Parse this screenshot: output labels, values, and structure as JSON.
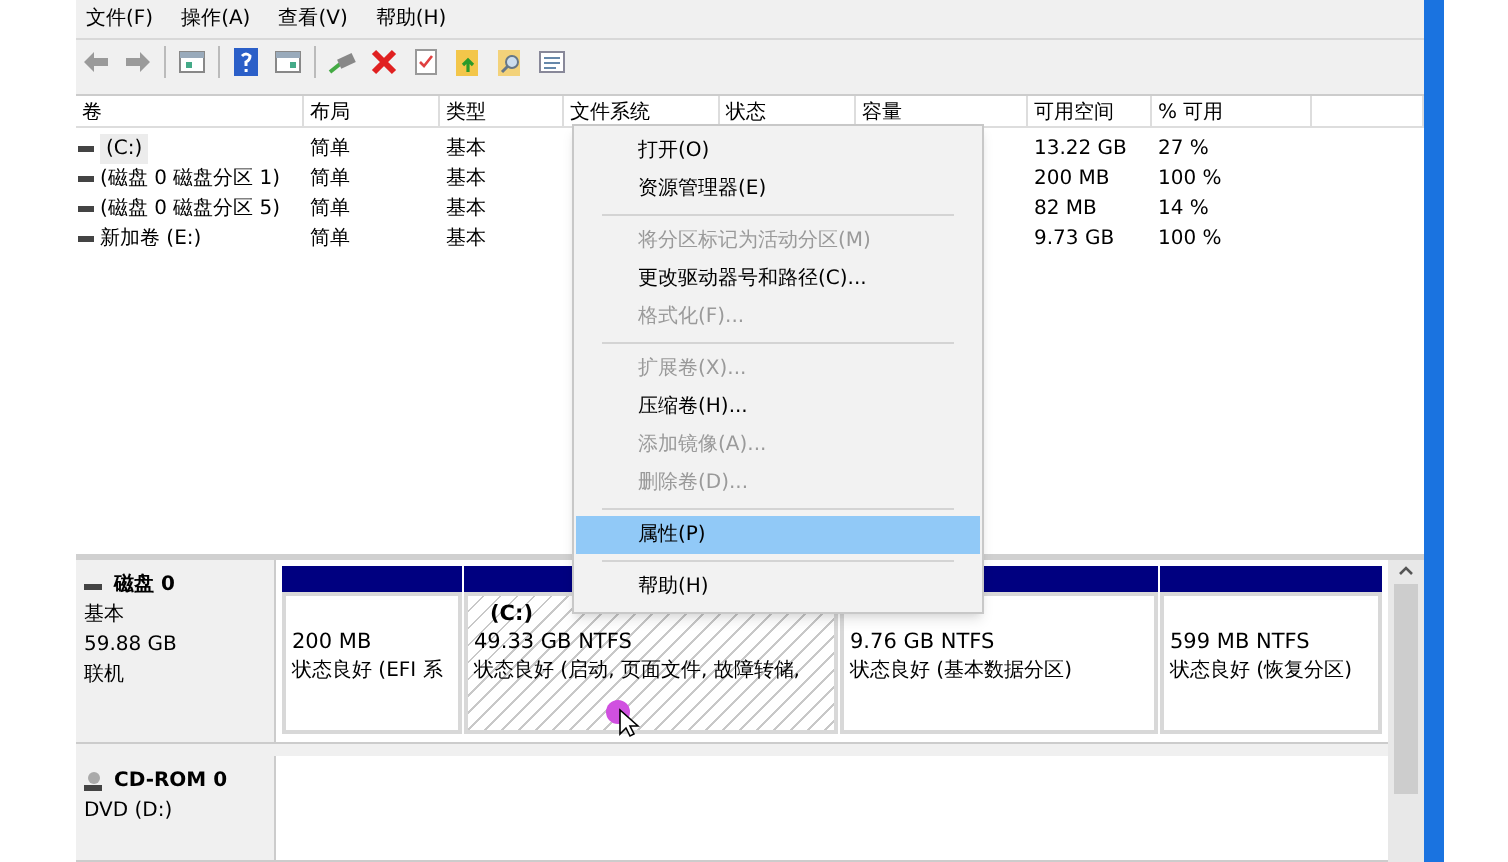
{
  "menu_bar": [
    {
      "label": "文件(F)"
    },
    {
      "label": "操作(A)"
    },
    {
      "label": "查看(V)"
    },
    {
      "label": "帮助(H)"
    }
  ],
  "volume_table": {
    "columns": [
      "卷",
      "布局",
      "类型",
      "文件系统",
      "状态",
      "容量",
      "可用空间",
      "% 可用"
    ],
    "rows": [
      {
        "volume": "(C:)",
        "layout": "简单",
        "type": "基本",
        "free": "13.22 GB",
        "percent": "27 %",
        "selected": true
      },
      {
        "volume": "(磁盘 0 磁盘分区 1)",
        "layout": "简单",
        "type": "基本",
        "free": "200 MB",
        "percent": "100 %",
        "selected": false
      },
      {
        "volume": "(磁盘 0 磁盘分区 5)",
        "layout": "简单",
        "type": "基本",
        "free": "82 MB",
        "percent": "14 %",
        "selected": false
      },
      {
        "volume": "新加卷 (E:)",
        "layout": "简单",
        "type": "基本",
        "free": "9.73 GB",
        "percent": "100 %",
        "selected": false
      }
    ]
  },
  "context_menu": [
    {
      "kind": "item",
      "label": "打开(O)",
      "disabled": false,
      "selected": false
    },
    {
      "kind": "item",
      "label": "资源管理器(E)",
      "disabled": false,
      "selected": false
    },
    {
      "kind": "separator"
    },
    {
      "kind": "item",
      "label": "将分区标记为活动分区(M)",
      "disabled": true,
      "selected": false
    },
    {
      "kind": "item",
      "label": "更改驱动器号和路径(C)...",
      "disabled": false,
      "selected": false
    },
    {
      "kind": "item",
      "label": "格式化(F)...",
      "disabled": true,
      "selected": false
    },
    {
      "kind": "separator"
    },
    {
      "kind": "item",
      "label": "扩展卷(X)...",
      "disabled": true,
      "selected": false
    },
    {
      "kind": "item",
      "label": "压缩卷(H)...",
      "disabled": false,
      "selected": false
    },
    {
      "kind": "item",
      "label": "添加镜像(A)...",
      "disabled": true,
      "selected": false
    },
    {
      "kind": "item",
      "label": "删除卷(D)...",
      "disabled": true,
      "selected": false
    },
    {
      "kind": "separator"
    },
    {
      "kind": "item",
      "label": "属性(P)",
      "disabled": false,
      "selected": true
    },
    {
      "kind": "separator"
    },
    {
      "kind": "item",
      "label": "帮助(H)",
      "disabled": false,
      "selected": false
    }
  ],
  "disks": [
    {
      "kind": "disk",
      "name": "磁盘 0",
      "lines": [
        "基本",
        "59.88 GB",
        "联机"
      ],
      "partitions": [
        {
          "size": "200 MB",
          "status": "状态良好 (EFI 系",
          "selected": false
        },
        {
          "title": "(C:)",
          "size": "49.33 GB NTFS",
          "status": "状态良好 (启动, 页面文件, 故障转储,",
          "selected": true
        },
        {
          "size": "9.76 GB NTFS",
          "status": "状态良好 (基本数据分区)",
          "selected": false
        },
        {
          "size": "599 MB NTFS",
          "status": "状态良好 (恢复分区)",
          "selected": false
        }
      ]
    },
    {
      "kind": "cdrom",
      "name": "CD-ROM 0",
      "lines": [
        "DVD (D:)"
      ]
    }
  ]
}
